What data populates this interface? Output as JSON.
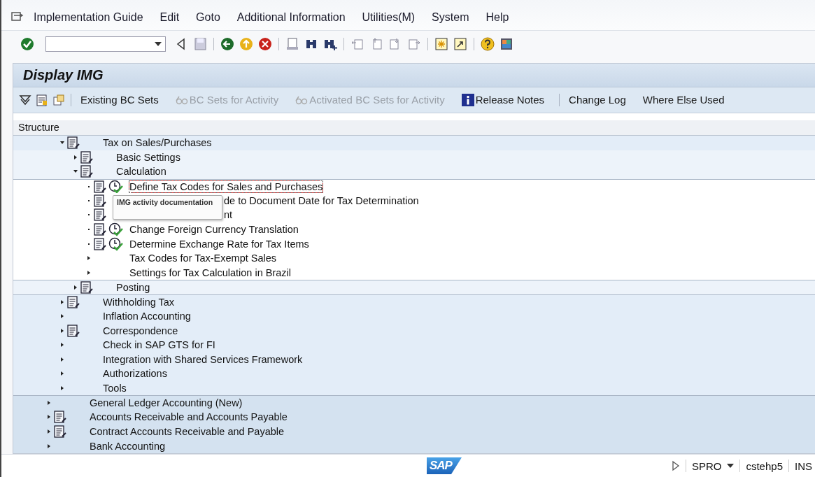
{
  "menu": [
    "Implementation Guide",
    "Edit",
    "Goto",
    "Additional Information",
    "Utilities(M)",
    "System",
    "Help"
  ],
  "title": "Display IMG",
  "app_toolbar": [
    {
      "kind": "icon"
    },
    {
      "kind": "icon"
    },
    {
      "kind": "icon"
    },
    {
      "kind": "text",
      "label": "Existing BC Sets",
      "disabled": false
    },
    {
      "kind": "linked",
      "label": "BC Sets for Activity",
      "disabled": true
    },
    {
      "kind": "linked",
      "label": "Activated BC Sets for Activity",
      "disabled": true
    },
    {
      "kind": "info",
      "label": "Release Notes",
      "disabled": false
    },
    {
      "kind": "text",
      "label": "Change Log",
      "disabled": false
    },
    {
      "kind": "text",
      "label": "Where Else Used",
      "disabled": false
    }
  ],
  "structure_header": "Structure",
  "tree": [
    {
      "children": [
        {
          "label": "Tax on Sales/Purchases",
          "kind": "node",
          "expanded": true,
          "doc": true,
          "children": [
            {
              "label": "Basic Settings",
              "kind": "node",
              "expanded": false,
              "doc": true
            },
            {
              "label": "Calculation",
              "kind": "node",
              "expanded": true,
              "doc": true,
              "children": [
                {
                  "label": "Define Tax Codes for Sales and Purchases",
                  "kind": "activity",
                  "doc": true,
                  "activity_icon": true,
                  "focused": true
                },
                {
                  "label": "de to Document Date for Tax Determination",
                  "kind": "activity",
                  "doc": true,
                  "activity_icon": false,
                  "covered": true
                },
                {
                  "label": "nt",
                  "kind": "activity",
                  "doc": true,
                  "activity_icon": false,
                  "covered": true
                },
                {
                  "label": "Change Foreign Currency Translation",
                  "kind": "activity",
                  "doc": true,
                  "activity_icon": true
                },
                {
                  "label": "Determine Exchange Rate for Tax Items",
                  "kind": "activity",
                  "doc": true,
                  "activity_icon": true
                },
                {
                  "label": "Tax Codes for Tax-Exempt Sales",
                  "kind": "node",
                  "expanded": false,
                  "doc": false
                },
                {
                  "label": "Settings for Tax Calculation in Brazil",
                  "kind": "node",
                  "expanded": false,
                  "doc": false
                }
              ]
            },
            {
              "label": "Posting",
              "kind": "node",
              "expanded": false,
              "doc": true
            }
          ]
        },
        {
          "label": "Withholding Tax",
          "kind": "node",
          "expanded": false,
          "doc": true
        },
        {
          "label": "Inflation Accounting",
          "kind": "node",
          "expanded": false,
          "doc": false
        },
        {
          "label": "Correspondence",
          "kind": "node",
          "expanded": false,
          "doc": true
        },
        {
          "label": "Check in SAP GTS for FI",
          "kind": "node",
          "expanded": false,
          "doc": false
        },
        {
          "label": "Integration with Shared Services Framework",
          "kind": "node",
          "expanded": false,
          "doc": false
        },
        {
          "label": "Authorizations",
          "kind": "node",
          "expanded": false,
          "doc": false
        },
        {
          "label": "Tools",
          "kind": "node",
          "expanded": false,
          "doc": false
        }
      ]
    },
    {
      "label": "General Ledger Accounting (New)",
      "kind": "node",
      "expanded": false,
      "doc": false
    },
    {
      "label": "Accounts Receivable and Accounts Payable",
      "kind": "node",
      "expanded": false,
      "doc": true
    },
    {
      "label": "Contract Accounts Receivable and Payable",
      "kind": "node",
      "expanded": false,
      "doc": true
    },
    {
      "label": "Bank Accounting",
      "kind": "node",
      "expanded": false,
      "doc": false
    }
  ],
  "tooltip": "IMG activity documentation",
  "status_bar": {
    "logo": "SAP",
    "transaction": "SPRO",
    "server": "cstehp5",
    "mode": "INS"
  }
}
